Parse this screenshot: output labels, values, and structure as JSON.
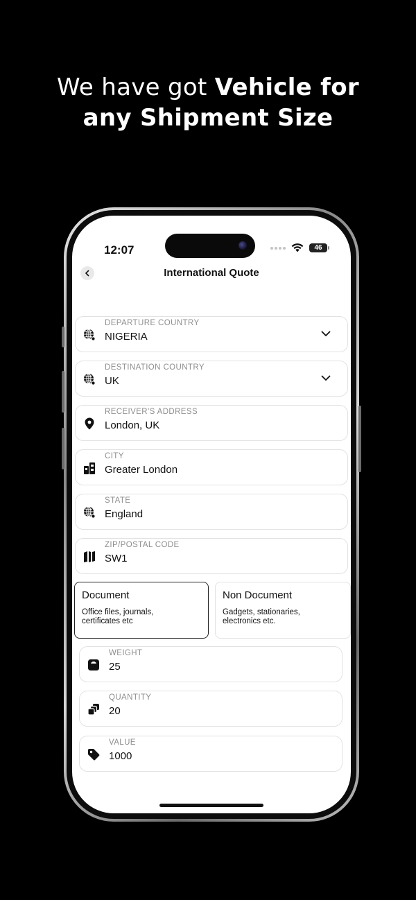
{
  "headline": {
    "line1_light": "We have got ",
    "line1_bold": "Vehicle for",
    "line2_bold": "any Shipment Size"
  },
  "status_bar": {
    "time": "12:07",
    "battery": "46"
  },
  "nav": {
    "title": "International Quote",
    "back_icon": "chevron-left-icon"
  },
  "fields": [
    {
      "label": "DEPARTURE COUNTRY",
      "value": "NIGERIA",
      "icon": "globe-search-icon",
      "dropdown": true
    },
    {
      "label": "DESTINATION COUNTRY",
      "value": "UK",
      "icon": "globe-search-icon",
      "dropdown": true
    },
    {
      "label": "RECEIVER'S ADDRESS",
      "value": "London, UK",
      "icon": "location-pin-icon",
      "dropdown": false
    },
    {
      "label": "CITY",
      "value": "Greater London",
      "icon": "buildings-icon",
      "dropdown": false
    },
    {
      "label": "STATE",
      "value": "England",
      "icon": "globe-search-icon",
      "dropdown": false
    },
    {
      "label": "ZIP/POSTAL CODE",
      "value": "SW1",
      "icon": "map-icon",
      "dropdown": false
    }
  ],
  "shipment_types": [
    {
      "title": "Document",
      "description": "Office files, journals, certificates etc",
      "selected": true
    },
    {
      "title": "Non Document",
      "description": "Gadgets, stationaries, electronics etc.",
      "selected": false
    }
  ],
  "package_fields": [
    {
      "label": "WEIGHT",
      "value": "25",
      "icon": "scale-icon"
    },
    {
      "label": "QUANTITY",
      "value": "20",
      "icon": "stack-icon"
    },
    {
      "label": "VALUE",
      "value": "1000",
      "icon": "price-tag-icon"
    }
  ],
  "colors": {
    "background": "#000000",
    "screen": "#ffffff",
    "text": "#111111",
    "label": "#8e8e8e",
    "border": "#e2e2e2",
    "selected_border": "#222222"
  }
}
